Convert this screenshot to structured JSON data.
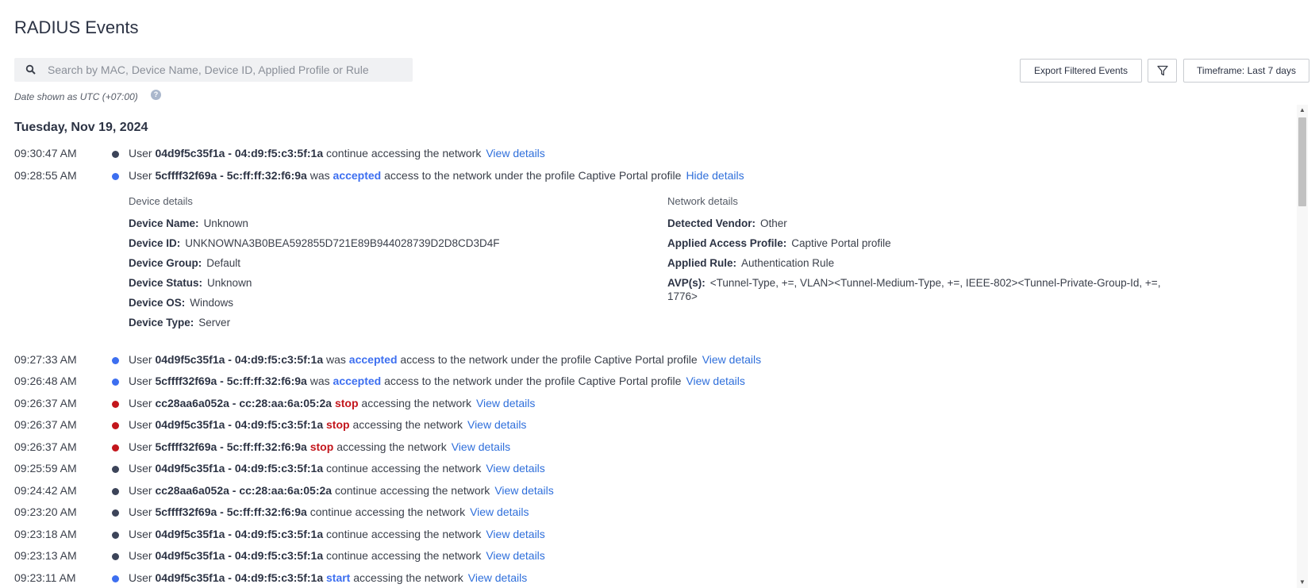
{
  "page": {
    "title": "RADIUS Events"
  },
  "search": {
    "placeholder": "Search by MAC, Device Name, Device ID, Applied Profile or Rule"
  },
  "toolbar": {
    "export_label": "Export Filtered Events",
    "timeframe_label": "Timeframe: Last 7 days"
  },
  "date_note": "Date shown as UTC (+07:00)",
  "help_symbol": "?",
  "day_heading": "Tuesday, Nov 19, 2024",
  "colors": {
    "continue_dot": "#3c4459",
    "accepted_dot": "#3d6ff0",
    "stop_dot": "#c3161c",
    "link": "#2f6fdb"
  },
  "events": [
    {
      "time": "09:30:47 AM",
      "user_prefix": "User",
      "user": "04d9f5c35f1a - 04:d9:f5:c3:5f:1a",
      "pre_status": "",
      "status": "",
      "post": "continue accessing the network",
      "link": "View details"
    },
    {
      "time": "09:28:55 AM",
      "user_prefix": "User",
      "user": "5cffff32f69a - 5c:ff:ff:32:f6:9a",
      "pre_status": "was",
      "status": "accepted",
      "post": "access to the network under the profile Captive Portal profile",
      "link": "Hide details"
    },
    {
      "time": "09:27:33 AM",
      "user_prefix": "User",
      "user": "04d9f5c35f1a - 04:d9:f5:c3:5f:1a",
      "pre_status": "was",
      "status": "accepted",
      "post": "access to the network under the profile Captive Portal profile",
      "link": "View details"
    },
    {
      "time": "09:26:48 AM",
      "user_prefix": "User",
      "user": "5cffff32f69a - 5c:ff:ff:32:f6:9a",
      "pre_status": "was",
      "status": "accepted",
      "post": "access to the network under the profile Captive Portal profile",
      "link": "View details"
    },
    {
      "time": "09:26:37 AM",
      "user_prefix": "User",
      "user": "cc28aa6a052a - cc:28:aa:6a:05:2a",
      "pre_status": "",
      "status": "stop",
      "post": "accessing the network",
      "link": "View details"
    },
    {
      "time": "09:26:37 AM",
      "user_prefix": "User",
      "user": "04d9f5c35f1a - 04:d9:f5:c3:5f:1a",
      "pre_status": "",
      "status": "stop",
      "post": "accessing the network",
      "link": "View details"
    },
    {
      "time": "09:26:37 AM",
      "user_prefix": "User",
      "user": "5cffff32f69a - 5c:ff:ff:32:f6:9a",
      "pre_status": "",
      "status": "stop",
      "post": "accessing the network",
      "link": "View details"
    },
    {
      "time": "09:25:59 AM",
      "user_prefix": "User",
      "user": "04d9f5c35f1a - 04:d9:f5:c3:5f:1a",
      "pre_status": "",
      "status": "",
      "post": "continue accessing the network",
      "link": "View details"
    },
    {
      "time": "09:24:42 AM",
      "user_prefix": "User",
      "user": "cc28aa6a052a - cc:28:aa:6a:05:2a",
      "pre_status": "",
      "status": "",
      "post": "continue accessing the network",
      "link": "View details"
    },
    {
      "time": "09:23:20 AM",
      "user_prefix": "User",
      "user": "5cffff32f69a - 5c:ff:ff:32:f6:9a",
      "pre_status": "",
      "status": "",
      "post": "continue accessing the network",
      "link": "View details"
    },
    {
      "time": "09:23:18 AM",
      "user_prefix": "User",
      "user": "04d9f5c35f1a - 04:d9:f5:c3:5f:1a",
      "pre_status": "",
      "status": "",
      "post": "continue accessing the network",
      "link": "View details"
    },
    {
      "time": "09:23:13 AM",
      "user_prefix": "User",
      "user": "04d9f5c35f1a - 04:d9:f5:c3:5f:1a",
      "pre_status": "",
      "status": "",
      "post": "continue accessing the network",
      "link": "View details"
    },
    {
      "time": "09:23:11 AM",
      "user_prefix": "User",
      "user": "04d9f5c35f1a - 04:d9:f5:c3:5f:1a",
      "pre_status": "",
      "status": "start",
      "post": "accessing the network",
      "link": "View details"
    }
  ],
  "details": {
    "device_heading": "Device details",
    "network_heading": "Network details",
    "device": [
      {
        "key": "Device Name:",
        "value": "Unknown"
      },
      {
        "key": "Device ID:",
        "value": "UNKNOWNA3B0BEA592855D721E89B944028739D2D8CD3D4F"
      },
      {
        "key": "Device Group:",
        "value": "Default"
      },
      {
        "key": "Device Status:",
        "value": "Unknown"
      },
      {
        "key": "Device OS:",
        "value": "Windows"
      },
      {
        "key": "Device Type:",
        "value": "Server"
      }
    ],
    "network": [
      {
        "key": "Detected Vendor:",
        "value": "Other"
      },
      {
        "key": "Applied Access Profile:",
        "value": "Captive Portal profile"
      },
      {
        "key": "Applied Rule:",
        "value": "Authentication Rule"
      },
      {
        "key": "AVP(s):",
        "value": "<Tunnel-Type, +=, VLAN><Tunnel-Medium-Type, +=, IEEE-802><Tunnel-Private-Group-Id, +=, 1776>"
      }
    ]
  }
}
